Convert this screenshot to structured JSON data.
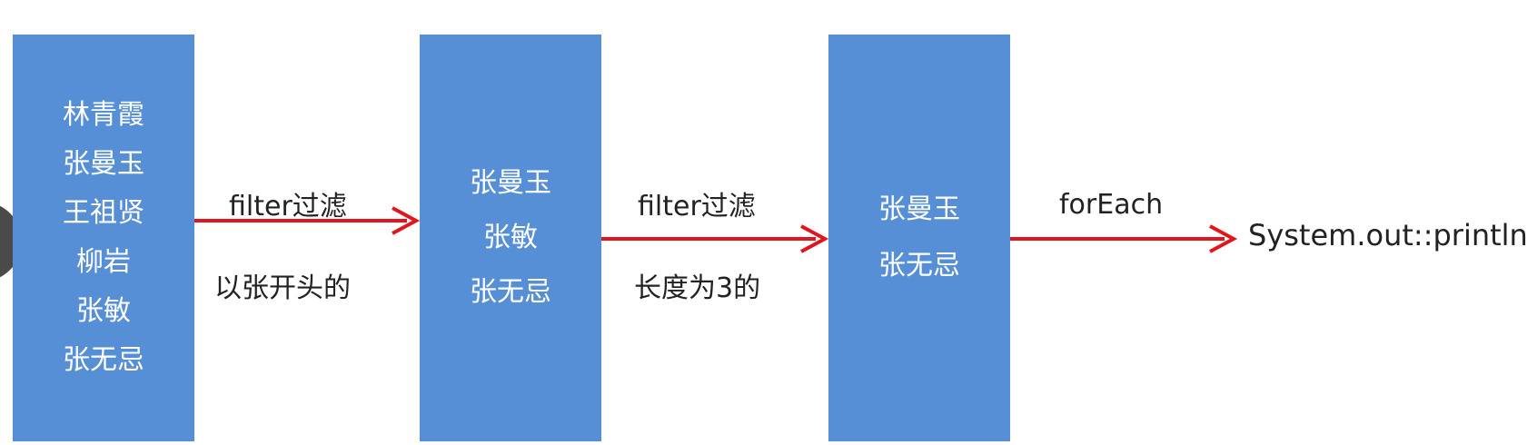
{
  "stages": [
    {
      "id": "source",
      "items": [
        "林青霞",
        "张曼玉",
        "王祖贤",
        "柳岩",
        "张敏",
        "张无忌"
      ]
    },
    {
      "id": "filtered-by-prefix",
      "items": [
        "张曼玉",
        "张敏",
        "张无忌"
      ]
    },
    {
      "id": "filtered-by-length",
      "items": [
        "张曼玉",
        "张无忌"
      ]
    }
  ],
  "arrows": [
    {
      "top_label": "filter过滤",
      "bottom_label": "以张开头的"
    },
    {
      "top_label": "filter过滤",
      "bottom_label": "长度为3的"
    },
    {
      "top_label": "forEach",
      "bottom_label": ""
    }
  ],
  "target": "System.out::println",
  "colors": {
    "box_fill": "#568fd6",
    "arrow": "#e0161c",
    "text_on_box": "#ffffff",
    "text": "#222222"
  }
}
